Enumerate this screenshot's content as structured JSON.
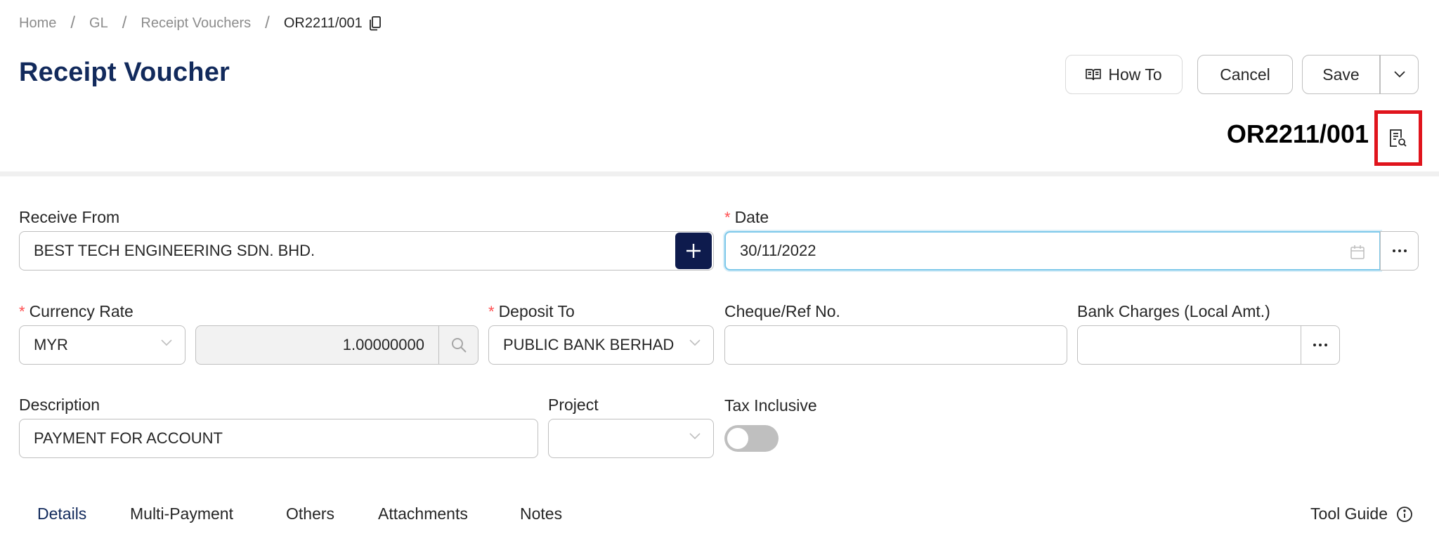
{
  "breadcrumb": {
    "home": "Home",
    "gl": "GL",
    "list": "Receipt Vouchers",
    "current": "OR2211/001"
  },
  "header": {
    "title": "Receipt Voucher",
    "how_to": "How To",
    "cancel": "Cancel",
    "save": "Save",
    "doc_no": "OR2211/001"
  },
  "form": {
    "receive_from": {
      "label": "Receive From",
      "value": "BEST TECH ENGINEERING SDN. BHD."
    },
    "date": {
      "label": "Date",
      "value": "30/11/2022"
    },
    "currency_rate": {
      "label": "Currency Rate",
      "currency": "MYR",
      "rate": "1.00000000"
    },
    "deposit_to": {
      "label": "Deposit To",
      "value": "PUBLIC BANK BERHAD"
    },
    "cheque_ref": {
      "label": "Cheque/Ref No.",
      "value": ""
    },
    "bank_charges": {
      "label": "Bank Charges (Local Amt.)",
      "value": ""
    },
    "description": {
      "label": "Description",
      "value": "PAYMENT FOR ACCOUNT"
    },
    "project": {
      "label": "Project",
      "value": ""
    },
    "tax_inclusive": {
      "label": "Tax Inclusive",
      "on": false
    },
    "required_mark": "*"
  },
  "tabs": {
    "details": "Details",
    "multi_payment": "Multi-Payment",
    "others": "Others",
    "attachments": "Attachments",
    "notes": "Notes",
    "tool_guide": "Tool Guide"
  },
  "colors": {
    "title": "#122a5c",
    "accent": "#0e1b4d",
    "highlight": "#e0141c",
    "focus": "#7cc8ea"
  }
}
